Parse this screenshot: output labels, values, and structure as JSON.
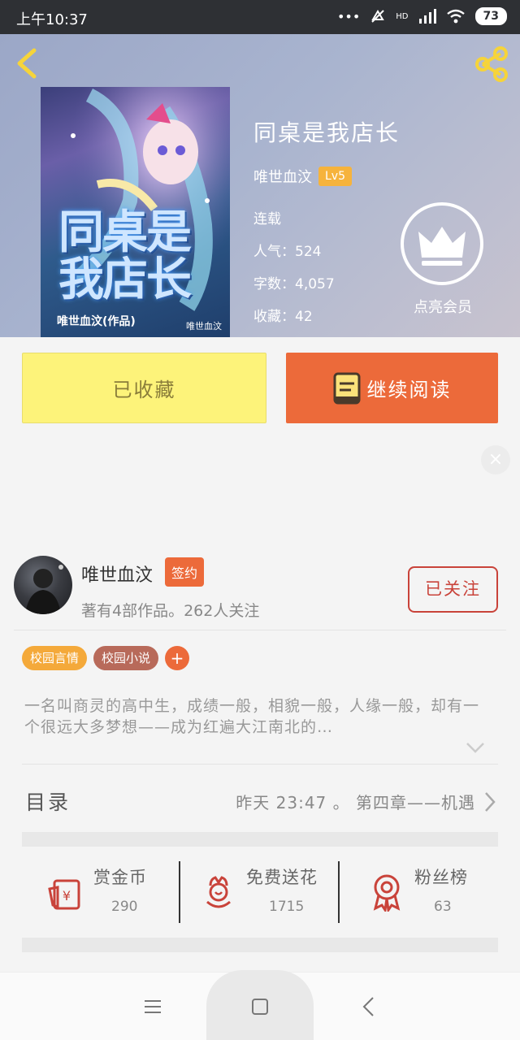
{
  "status_bar": {
    "time": "上午10:37",
    "battery": "73",
    "network": "HD"
  },
  "book": {
    "title": "同桌是我店长",
    "author": "唯世血汶",
    "author_level": "Lv5",
    "status": "连载",
    "popularity": "人气：524",
    "word_count": "字数：4,057",
    "favorites": "收藏：42",
    "cover_title": "同桌是我店长",
    "cover_author": "唯世血汶(作品)",
    "cover_pen": "唯世血汶"
  },
  "vip": {
    "label": "点亮会员"
  },
  "buttons": {
    "favorited": "已收藏",
    "continue_reading": "继续阅读"
  },
  "author_card": {
    "name": "唯世血汶",
    "badge": "签约",
    "stats": "著有4部作品。262人关注",
    "follow": "已关注"
  },
  "tags": [
    {
      "label": "校园言情"
    },
    {
      "label": "校园小说"
    },
    {
      "label": "+"
    }
  ],
  "synopsis": "一名叫商灵的高中生，成绩一般，相貌一般，人缘一般，却有一个很远大多梦想——成为红遍大江南北的…",
  "toc": {
    "title": "目录",
    "latest": "昨天 23:47 。 第四章——机遇"
  },
  "actions": [
    {
      "label": "赏金币",
      "value": "290"
    },
    {
      "label": "免费送花",
      "value": "1715"
    },
    {
      "label": "粉丝榜",
      "value": "63"
    }
  ],
  "colors": {
    "accent": "#ec6a3a",
    "yellow": "#fdf37a",
    "tag_orange": "#f4a93a",
    "follow_red": "#c9433a"
  }
}
